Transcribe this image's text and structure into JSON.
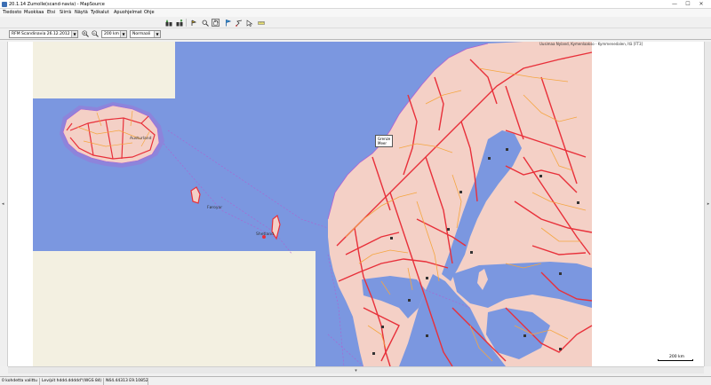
{
  "window": {
    "title": "20.1.14 Zumolle(scand-navia) - MapSource",
    "icon": "mapsource-app-icon",
    "controls": {
      "minimize": "—",
      "maximize": "☐",
      "close": "✕"
    }
  },
  "menu": {
    "items": [
      "Tiedosto",
      "Muokkaa",
      "Etsi",
      "Siirrä",
      "Näytä",
      "Työkalut",
      "Apuohjelmat",
      "Ohje"
    ]
  },
  "toolbar": {
    "icons": [
      "receive-from-device-icon",
      "send-to-device-icon",
      "zoom-tool-icon",
      "selection-tool-icon",
      "hand-tool-icon",
      "waypoint-tool-icon",
      "route-tool-icon",
      "measure-tool-icon",
      "distance-tool-icon",
      "map-tool-icon"
    ]
  },
  "toolbar2": {
    "product_select": "RFM Scandinavia 26.12.2012",
    "zoom_select": "200 km",
    "detail_select": "Normaali"
  },
  "map": {
    "labels": {
      "iceland_region": "Austurland",
      "faroe": "Føroyar",
      "shetland": "Shetland",
      "uusimaa": "Uusimaa Nyland, Kymenlaakso - Kymmenedalen, Itä [FT3]"
    },
    "tooltip": {
      "line1": "Grenze",
      "line2": "Meer"
    },
    "scale_label": "200 km",
    "colors": {
      "sea": "#7b97e0",
      "land": "#f4d0c6",
      "road_major": "#e8303a",
      "road_minor": "#f5a640",
      "border": "#b060d0",
      "uncovered": "#f3f0e1"
    }
  },
  "status": {
    "selection": "0 kohdetta valittu",
    "format": "Lev/pit hddd.ddddd°(WGS 84)",
    "coords": "N64.44313 E9.10852"
  }
}
